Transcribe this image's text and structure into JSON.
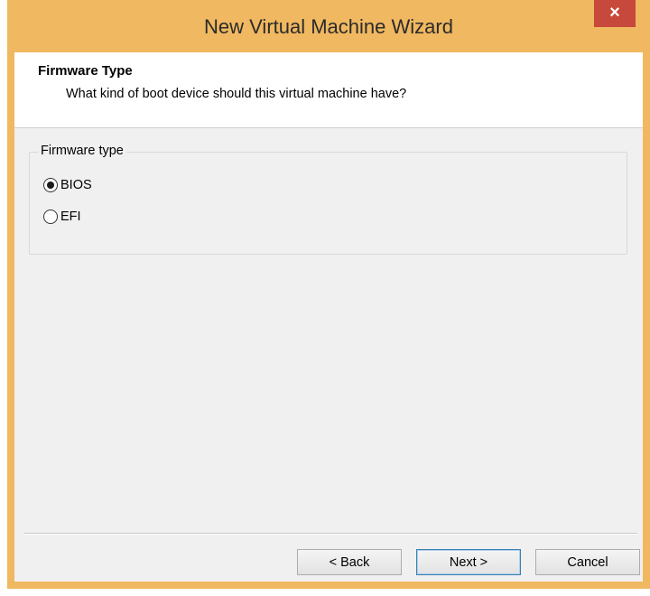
{
  "window": {
    "title": "New Virtual Machine Wizard",
    "close_glyph": "×"
  },
  "header": {
    "title": "Firmware Type",
    "subtitle": "What kind of boot device should this virtual machine have?"
  },
  "firmware_group": {
    "legend": "Firmware type",
    "options": [
      {
        "label": "BIOS",
        "selected": true
      },
      {
        "label": "EFI",
        "selected": false
      }
    ]
  },
  "buttons": {
    "back": "< Back",
    "next": "Next >",
    "cancel": "Cancel"
  },
  "colors": {
    "frame": "#f0b860",
    "close_button": "#c7493b",
    "client_bg": "#f0f0f0",
    "default_button_border": "#3c7fb1"
  },
  "icons": {
    "close": "close-icon",
    "radio_selected": "radio-selected-icon",
    "radio_unselected": "radio-unselected-icon"
  }
}
